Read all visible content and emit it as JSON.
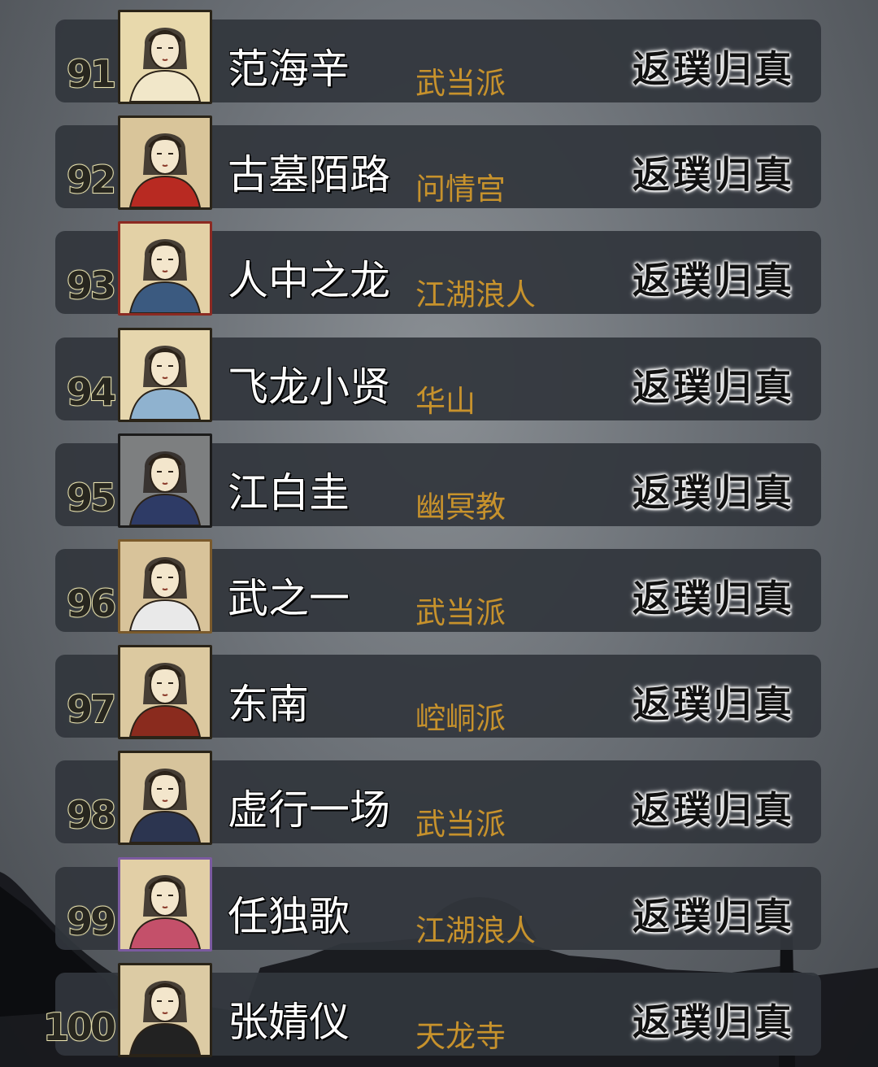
{
  "leaderboard": {
    "entries": [
      {
        "rank": "91",
        "name": "范海辛",
        "sect": "武当派",
        "realm": "返璞归真",
        "frame": "#2a2418",
        "bg": "#e8d9ac",
        "accent": "#f1e7c9"
      },
      {
        "rank": "92",
        "name": "古墓陌路",
        "sect": "问情宫",
        "realm": "返璞归真",
        "frame": "#2a2418",
        "bg": "#d9c59a",
        "accent": "#b82a22"
      },
      {
        "rank": "93",
        "name": "人中之龙",
        "sect": "江湖浪人",
        "realm": "返璞归真",
        "frame": "#8c2a22",
        "bg": "#e3d1a6",
        "accent": "#3b5a80"
      },
      {
        "rank": "94",
        "name": "飞龙小贤",
        "sect": "华山",
        "realm": "返璞归真",
        "frame": "#2a2418",
        "bg": "#e6d6ad",
        "accent": "#8fb2cf"
      },
      {
        "rank": "95",
        "name": "江白圭",
        "sect": "幽冥教",
        "realm": "返璞归真",
        "frame": "#1b1b1b",
        "bg": "#7d7f80",
        "accent": "#2e3b66"
      },
      {
        "rank": "96",
        "name": "武之一",
        "sect": "武当派",
        "realm": "返璞归真",
        "frame": "#7a5a2c",
        "bg": "#d8c39a",
        "accent": "#e9e9e9"
      },
      {
        "rank": "97",
        "name": "东南",
        "sect": "崆峒派",
        "realm": "返璞归真",
        "frame": "#2a2418",
        "bg": "#dcc9a0",
        "accent": "#8a2b1e"
      },
      {
        "rank": "98",
        "name": "虚行一场",
        "sect": "武当派",
        "realm": "返璞归真",
        "frame": "#2a2418",
        "bg": "#d7c49c",
        "accent": "#2c3550"
      },
      {
        "rank": "99",
        "name": "任独歌",
        "sect": "江湖浪人",
        "realm": "返璞归真",
        "frame": "#7b5aa0",
        "bg": "#e2cfa6",
        "accent": "#c4506a"
      },
      {
        "rank": "100",
        "name": "张婧仪",
        "sect": "天龙寺",
        "realm": "返璞归真",
        "frame": "#2a2418",
        "bg": "#dccba4",
        "accent": "#222222"
      }
    ]
  }
}
